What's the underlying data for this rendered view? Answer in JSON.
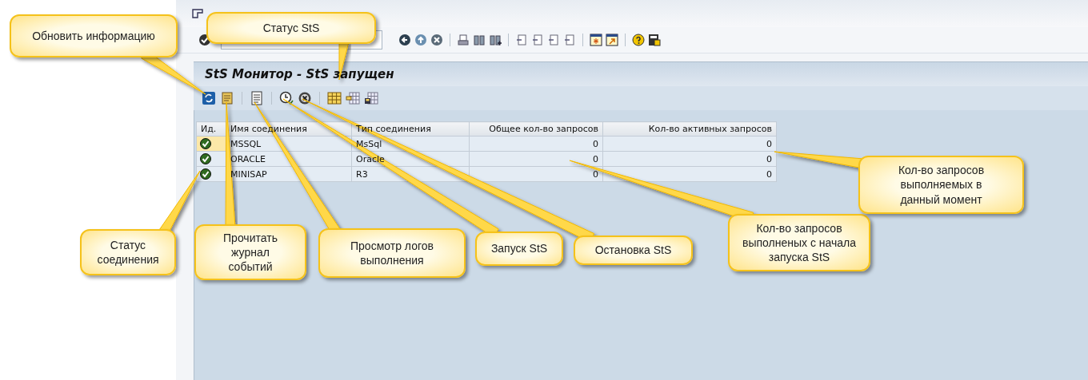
{
  "screen": {
    "title": "StS Монитор - StS запущен"
  },
  "table": {
    "columns": [
      {
        "label": "Ид."
      },
      {
        "label": "Имя соединения"
      },
      {
        "label": "Тип соединения"
      },
      {
        "label": "Общее кол-во запросов"
      },
      {
        "label": "Кол-во активных запросов"
      }
    ],
    "rows": [
      {
        "selected": true,
        "name": "MSSQL",
        "type": "MsSql",
        "total": "0",
        "active": "0"
      },
      {
        "selected": false,
        "name": "ORACLE",
        "type": "Oracle",
        "total": "0",
        "active": "0"
      },
      {
        "selected": false,
        "name": "MINISAP",
        "type": "R3",
        "total": "0",
        "active": "0"
      }
    ]
  },
  "callouts": [
    {
      "text": "Обновить информацию"
    },
    {
      "text": "Статус StS"
    },
    {
      "text": "Статус\nсоединения"
    },
    {
      "text": "Прочитать\nжурнал\nсобытий"
    },
    {
      "text": "Просмотр логов\nвыполнения"
    },
    {
      "text": "Запуск StS"
    },
    {
      "text": "Остановка StS"
    },
    {
      "text": "Кол-во запросов\nвыполненых с начала\nзапуска StS"
    },
    {
      "text": "Кол-во запросов\nвыполняемых в\nданный момент"
    }
  ]
}
